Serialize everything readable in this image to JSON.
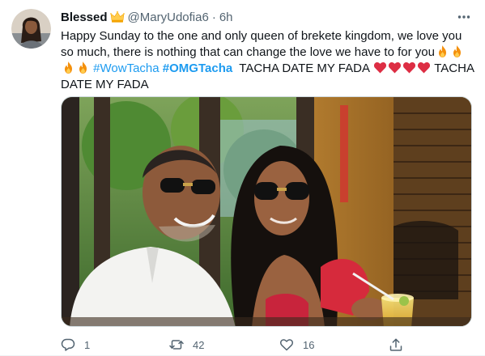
{
  "tweet": {
    "author_name": "Blessed",
    "badge_icon": "crown-emoji-icon",
    "handle": "@MaryUdofia6",
    "separator": "·",
    "time": "6h",
    "text": {
      "line1": "Happy Sunday to the one and only queen of brekete kingdom, we love you",
      "line2": "so much, there is nothing that can change the love we have to for you",
      "hashtag1": "#WowTacha",
      "hashtag2": "#OMGTacha",
      "line3_tail": "TACHA DATE MY FADA",
      "line4_start": "TACHA",
      "line4": "DATE MY FADA"
    },
    "emojis": {
      "fire": "fire-emoji-icon",
      "heart": "red-heart-emoji-icon"
    },
    "media": {
      "description_icon": "photo-man-woman-sunglasses"
    },
    "actions": {
      "reply_count": "1",
      "retweet_count": "42",
      "like_count": "16"
    }
  },
  "colors": {
    "link": "#1d9bf0",
    "secondary_text": "#536471",
    "primary_text": "#0f1419",
    "heart": "#e0245e",
    "fire": "#f4900c"
  }
}
